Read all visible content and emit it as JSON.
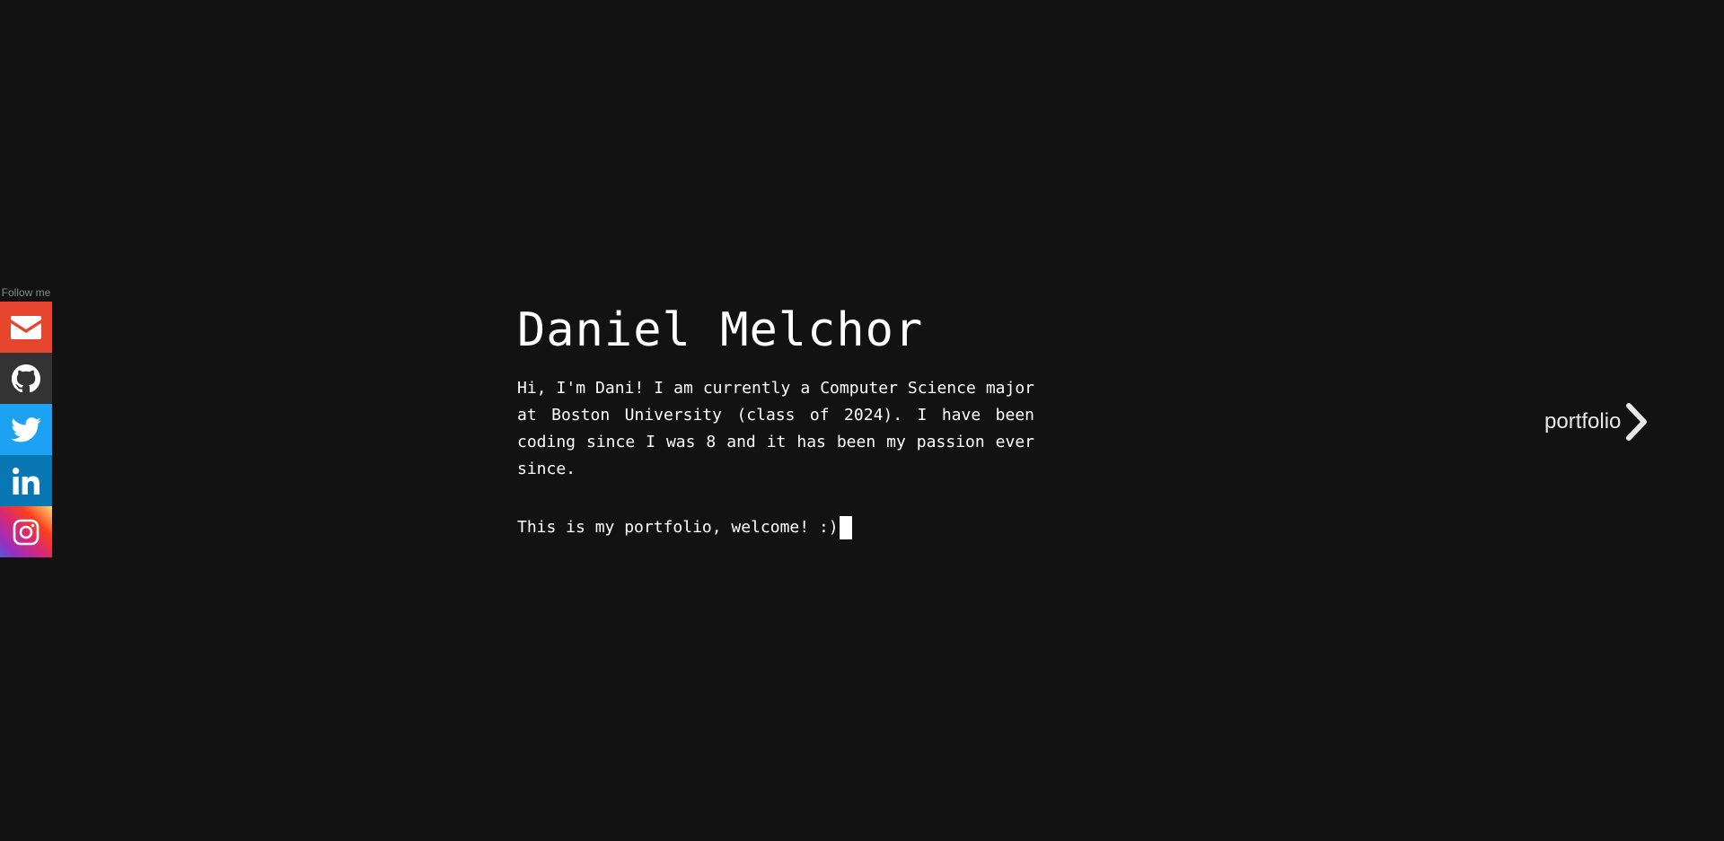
{
  "social": {
    "label": "Follow me",
    "items": [
      {
        "name": "email",
        "icon": "envelope-icon",
        "color": "#e8452f"
      },
      {
        "name": "github",
        "icon": "github-icon",
        "color": "#333333"
      },
      {
        "name": "twitter",
        "icon": "twitter-icon",
        "color": "#1da1f2"
      },
      {
        "name": "linkedin",
        "icon": "linkedin-icon",
        "color": "#0a77b5"
      },
      {
        "name": "instagram",
        "icon": "instagram-icon",
        "color": "#d62976"
      }
    ]
  },
  "main": {
    "name": "Daniel Melchor",
    "bio": "Hi, I'm Dani! I am currently a Computer Science major at Boston University (class of 2024). I have been coding since I was 8 and it has been my passion ever since.",
    "typed_text": "This is my portfolio, welcome! :)"
  },
  "nav": {
    "portfolio_label": "portfolio",
    "icon": "chevron-right-icon"
  },
  "colors": {
    "background": "#121212",
    "text": "#ffffff",
    "muted": "#8a8a8a"
  }
}
